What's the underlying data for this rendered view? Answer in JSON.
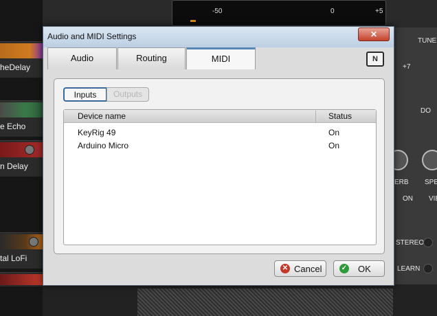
{
  "background": {
    "effects": [
      "heDelay",
      "e Echo",
      "n Delay",
      "tal LoFi"
    ],
    "meter": {
      "labels": [
        "-50",
        "0",
        "+5"
      ],
      "extra": "+7",
      "tune": "TUNE"
    },
    "right_labels": [
      "ERB",
      "SPE",
      "ON",
      "VIBRA",
      "STEREO",
      "LEARN",
      "DO"
    ]
  },
  "dialog": {
    "title": "Audio and MIDI Settings",
    "close_label": "✕",
    "tabs": [
      {
        "label": "Audio"
      },
      {
        "label": "Routing"
      },
      {
        "label": "MIDI"
      }
    ],
    "logo_text": "N",
    "segments": {
      "inputs": "Inputs",
      "outputs": "Outputs"
    },
    "table": {
      "headers": {
        "name": "Device name",
        "status": "Status"
      },
      "rows": [
        {
          "name": "KeyRig 49",
          "status": "On"
        },
        {
          "name": "Arduino Micro",
          "status": "On"
        }
      ]
    },
    "buttons": {
      "cancel": "Cancel",
      "ok": "OK"
    }
  }
}
